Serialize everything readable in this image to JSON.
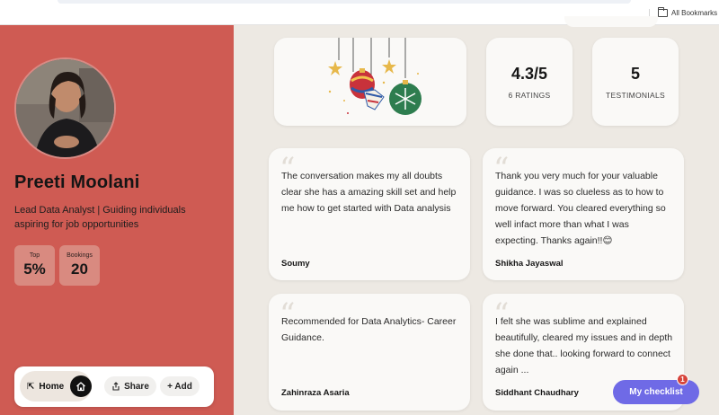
{
  "browser": {
    "bookmarks_label": "All Bookmarks"
  },
  "profile": {
    "name": "Preeti Moolani",
    "bio": "Lead Data Analyst | Guiding individuals aspiring for job opportunities",
    "stats": [
      {
        "label": "Top",
        "value": "5%"
      },
      {
        "label": "Bookings",
        "value": "20"
      }
    ]
  },
  "actions": {
    "home_label": "Home",
    "share_label": "Share",
    "add_label": "+ Add"
  },
  "summary": {
    "rating_value": "4.3/5",
    "rating_label": "6 RATINGS",
    "testimonials_value": "5",
    "testimonials_label": "TESTIMONIALS"
  },
  "testimonials": [
    {
      "text": "The conversation makes my all doubts clear she has a amazing skill set and help me how to get started with Data analysis",
      "author": "Soumy"
    },
    {
      "text": "Thank you very much for your valuable guidance. I was so clueless as to how to move forward. You cleared everything so well infact more than what I was expecting. Thanks again!!😊",
      "author": "Shikha Jayaswal"
    },
    {
      "text": "Recommended for Data Analytics- Career Guidance.",
      "author": "Zahinraza Asaria"
    },
    {
      "text": "I felt she was sublime and explained beautifully, cleared my issues and in depth she done that.. looking forward to connect again ...",
      "author": "Siddhant Chaudhary"
    }
  ],
  "checklist": {
    "label": "My checklist",
    "badge": "1"
  },
  "colors": {
    "profile_bg": "#cf5b53",
    "accent_purple": "#6f6ae6",
    "page_bg": "#ede9e3"
  }
}
